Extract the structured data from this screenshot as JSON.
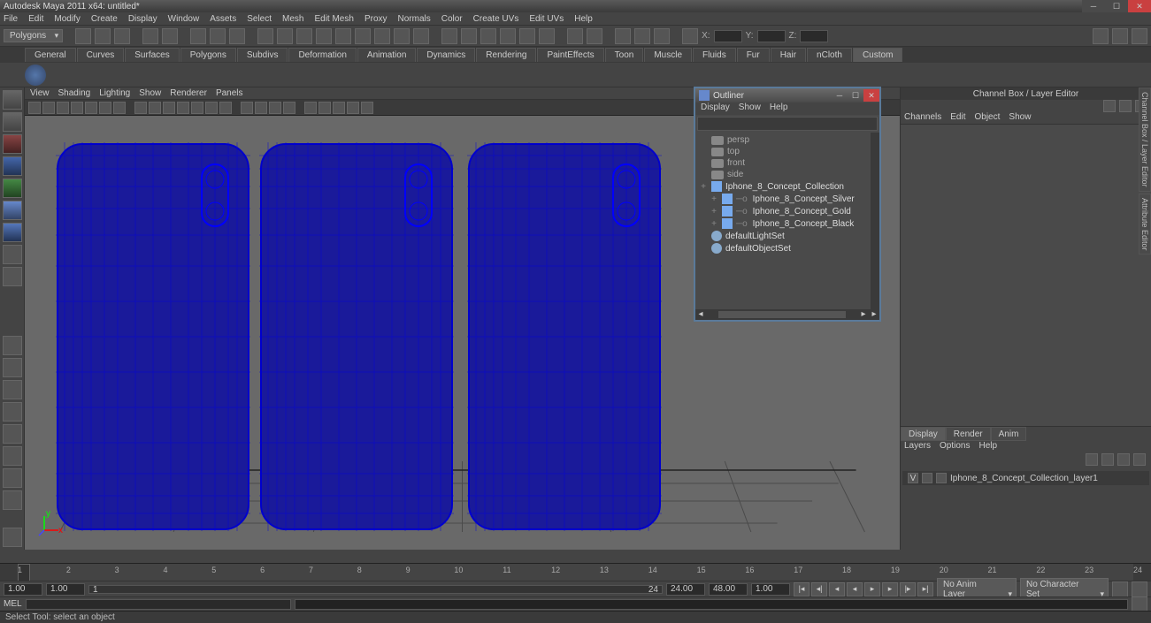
{
  "window": {
    "title": "Autodesk Maya 2011 x64: untitled*"
  },
  "mainmenu": [
    "File",
    "Edit",
    "Modify",
    "Create",
    "Display",
    "Window",
    "Assets",
    "Select",
    "Mesh",
    "Edit Mesh",
    "Proxy",
    "Normals",
    "Color",
    "Create UVs",
    "Edit UVs",
    "Help"
  ],
  "moduleDropdown": "Polygons",
  "coords": {
    "x": "X:",
    "y": "Y:",
    "z": "Z:"
  },
  "shelftabs": [
    "General",
    "Curves",
    "Surfaces",
    "Polygons",
    "Subdivs",
    "Deformation",
    "Animation",
    "Dynamics",
    "Rendering",
    "PaintEffects",
    "Toon",
    "Muscle",
    "Fluids",
    "Fur",
    "Hair",
    "nCloth",
    "Custom"
  ],
  "shelftab_active": "Custom",
  "viewmenu": [
    "View",
    "Shading",
    "Lighting",
    "Show",
    "Renderer",
    "Panels"
  ],
  "outliner": {
    "title": "Outliner",
    "menu": [
      "Display",
      "Show",
      "Help"
    ],
    "items": [
      {
        "type": "cam",
        "label": "persp",
        "indent": 1
      },
      {
        "type": "cam",
        "label": "top",
        "indent": 1
      },
      {
        "type": "cam",
        "label": "front",
        "indent": 1
      },
      {
        "type": "cam",
        "label": "side",
        "indent": 1
      },
      {
        "type": "grp",
        "label": "Iphone_8_Concept_Collection",
        "indent": 0,
        "exp": "+"
      },
      {
        "type": "grp",
        "label": "Iphone_8_Concept_Silver",
        "indent": 1,
        "exp": "+",
        "pre": "o"
      },
      {
        "type": "grp",
        "label": "Iphone_8_Concept_Gold",
        "indent": 1,
        "exp": "+",
        "pre": "o"
      },
      {
        "type": "grp",
        "label": "Iphone_8_Concept_Black",
        "indent": 1,
        "exp": "+",
        "pre": "o"
      },
      {
        "type": "set",
        "label": "defaultLightSet",
        "indent": 1
      },
      {
        "type": "set",
        "label": "defaultObjectSet",
        "indent": 1
      }
    ]
  },
  "channelbox": {
    "title": "Channel Box / Layer Editor",
    "tabs": [
      "Channels",
      "Edit",
      "Object",
      "Show"
    ],
    "btabs": [
      "Display",
      "Render",
      "Anim"
    ],
    "btab_active": "Display",
    "bmenu": [
      "Layers",
      "Options",
      "Help"
    ],
    "layer": {
      "vis": "V",
      "name": "Iphone_8_Concept_Collection_layer1"
    }
  },
  "sidetabs": [
    "Channel Box / Layer Editor",
    "Attribute Editor"
  ],
  "timeline": {
    "ticks": [
      1,
      2,
      3,
      4,
      5,
      6,
      7,
      8,
      9,
      10,
      11,
      12,
      13,
      14,
      15,
      16,
      17,
      18,
      19,
      20,
      21,
      22,
      23,
      24
    ],
    "current": 1
  },
  "range": {
    "startOuter": "1.00",
    "startInner": "1.00",
    "sliderStart": "1",
    "sliderEnd": "24",
    "endInner": "24.00",
    "endOuter": "48.00",
    "fpsField": "1.00",
    "animLayer": "No Anim Layer",
    "charSet": "No Character Set"
  },
  "cmd": {
    "label": "MEL"
  },
  "helpline": "Select Tool: select an object"
}
